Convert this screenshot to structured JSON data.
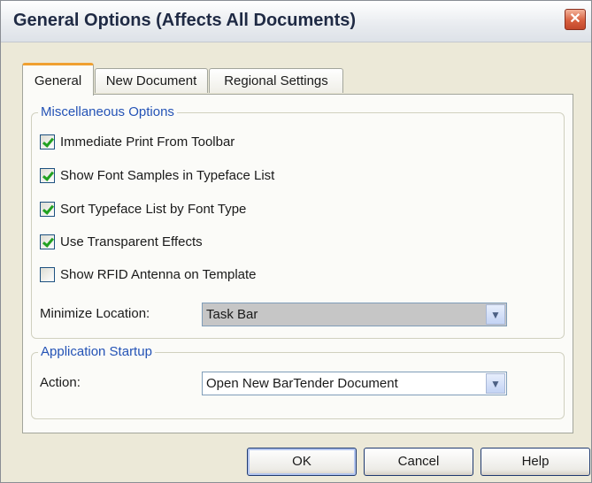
{
  "window": {
    "title": "General Options (Affects All Documents)",
    "close_glyph": "✕"
  },
  "tabs": [
    {
      "label": "General",
      "active": true
    },
    {
      "label": "New Document",
      "active": false
    },
    {
      "label": "Regional Settings",
      "active": false
    }
  ],
  "misc": {
    "legend": "Miscellaneous Options",
    "options": [
      {
        "label": "Immediate Print From Toolbar",
        "checked": true
      },
      {
        "label": "Show Font Samples in Typeface List",
        "checked": true
      },
      {
        "label": "Sort Typeface List by Font Type",
        "checked": true
      },
      {
        "label": "Use Transparent Effects",
        "checked": true
      },
      {
        "label": "Show RFID Antenna on Template",
        "checked": false
      }
    ],
    "minimize_label": "Minimize Location:",
    "minimize_value": "Task Bar"
  },
  "startup": {
    "legend": "Application Startup",
    "action_label": "Action:",
    "action_value": "Open New BarTender Document"
  },
  "buttons": {
    "ok": "OK",
    "cancel": "Cancel",
    "help": "Help"
  },
  "colors": {
    "legend_text": "#2453b6",
    "active_tab_accent": "#f0a030",
    "checkmark": "#21a121",
    "dialog_bg": "#ece9d8",
    "panel_bg": "#fbfbf8"
  }
}
